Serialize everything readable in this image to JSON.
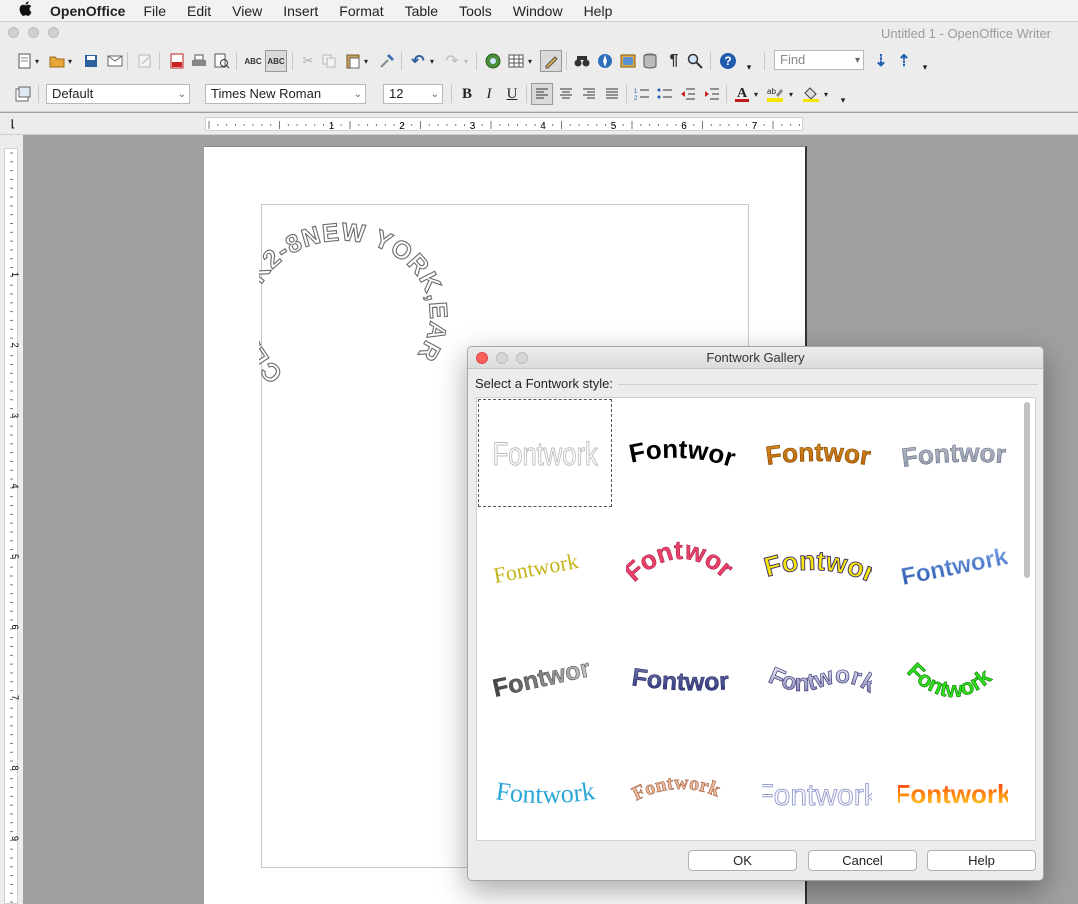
{
  "menubar": {
    "app_name": "OpenOffice",
    "items": [
      "File",
      "Edit",
      "View",
      "Insert",
      "Format",
      "Table",
      "Tools",
      "Window",
      "Help"
    ]
  },
  "window": {
    "title": "Untitled 1 - OpenOffice Writer"
  },
  "toolbar": {
    "find_placeholder": "Find",
    "paragraph_style": "Default",
    "font_name": "Times New Roman",
    "font_size": "12"
  },
  "ruler": {
    "labels": [
      "1",
      "2",
      "3",
      "4",
      "5",
      "6",
      "7"
    ],
    "vlabels": [
      "1",
      "2",
      "3",
      "4",
      "5",
      "6",
      "7",
      "8",
      "9"
    ]
  },
  "document": {
    "fontwork_text": "CLASS K2-8NEW YORK,EARTH"
  },
  "dialog": {
    "title": "Fontwork Gallery",
    "prompt": "Select a Fontwork style:",
    "items": [
      {
        "text": "Fontwork",
        "style": "outline-gray"
      },
      {
        "text": "Fontwork",
        "style": "black-arch"
      },
      {
        "text": "Fontwork",
        "style": "gold"
      },
      {
        "text": "Fontwork",
        "style": "silver"
      },
      {
        "text": "Fontwork",
        "style": "yellow-serif"
      },
      {
        "text": "Fontwork",
        "style": "pink-arch"
      },
      {
        "text": "Fontwork",
        "style": "yellow-bold"
      },
      {
        "text": "Fontwork",
        "style": "blue-slant"
      },
      {
        "text": "Fontwork",
        "style": "gray-3d"
      },
      {
        "text": "Fontwork",
        "style": "navy-3d"
      },
      {
        "text": "Fontwork",
        "style": "purple-wave"
      },
      {
        "text": "Fontwork",
        "style": "green-arch"
      },
      {
        "text": "Fontwork",
        "style": "cyan-serif"
      },
      {
        "text": "Fontwork",
        "style": "brown-arch"
      },
      {
        "text": "Fontwork",
        "style": "lavender-outline"
      },
      {
        "text": "Fontwork",
        "style": "red-orange"
      }
    ],
    "buttons": {
      "ok": "OK",
      "cancel": "Cancel",
      "help": "Help"
    }
  },
  "colors": {
    "selection": "#555555",
    "close": "#fc605c",
    "window_bg": "#ececec"
  }
}
